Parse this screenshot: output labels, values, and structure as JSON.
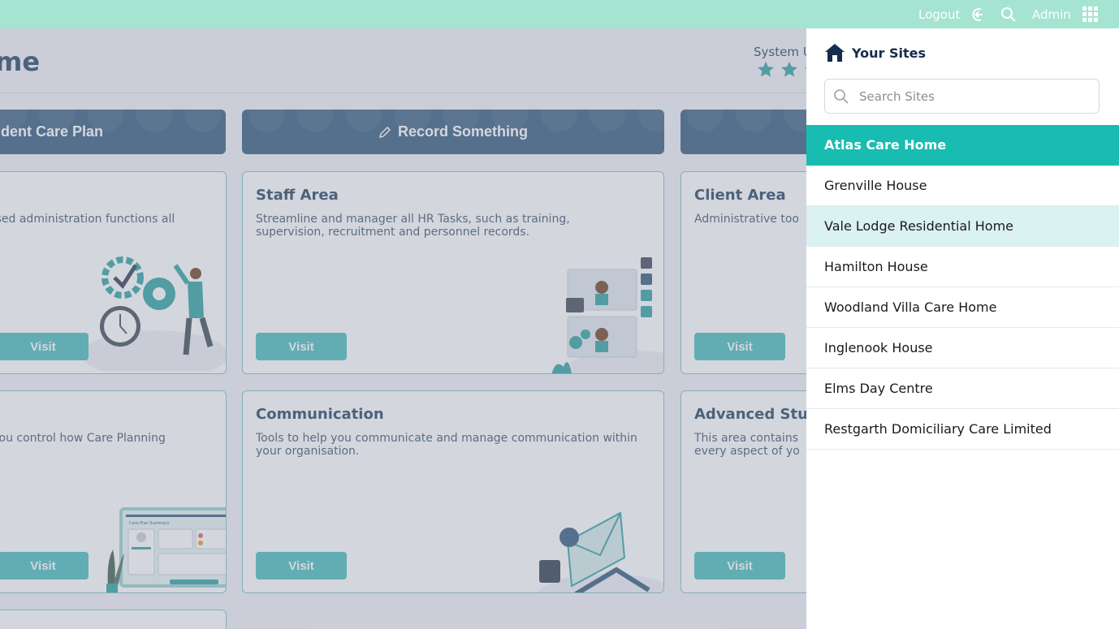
{
  "topbar": {
    "logout_label": "Logout",
    "admin_label": "Admin"
  },
  "page": {
    "title": "me",
    "system_label": "System U",
    "stars_shown": 3
  },
  "actions": [
    {
      "label": "sident Care Plan"
    },
    {
      "label": "Record Something",
      "icon": "pencil-icon"
    },
    {
      "label": ""
    }
  ],
  "cards": [
    {
      "title": "",
      "description": "y used administration functions all",
      "visit_label": "Visit"
    },
    {
      "title": "Staff Area",
      "description": "Streamline and manager all HR Tasks, such as training, supervision, recruitment and personnel records.",
      "visit_label": "Visit"
    },
    {
      "title": "Client Area",
      "description": "Administrative too",
      "visit_label": "Visit"
    },
    {
      "title": "",
      "description": "lp you control how Care Planning",
      "visit_label": "Visit"
    },
    {
      "title": "Communication",
      "description": "Tools to help you communicate and manage communication within your organisation.",
      "visit_label": "Visit"
    },
    {
      "title": "Advanced Stuff",
      "description": "This area contains every aspect of yo",
      "visit_label": "Visit"
    }
  ],
  "illustration_texts": {
    "care_plan_summary": "Care Plan Summary"
  },
  "sites_panel": {
    "title": "Your Sites",
    "search_placeholder": "Search Sites",
    "sites": [
      "Atlas Care Home",
      "Grenville House",
      "Vale Lodge Residential Home",
      "Hamilton House",
      "Woodland Villa Care Home",
      "Inglenook House",
      "Elms Day Centre",
      "Restgarth Domiciliary Care Limited"
    ],
    "active_index": 0,
    "hover_index": 2
  },
  "colors": {
    "topbar": "#a4e4d1",
    "action_button": "#3e6484",
    "visit_button": "#53c1c1",
    "active_site": "#19bcb0",
    "hover_site": "#daf2f1",
    "teal_accent": "#3aa7a8"
  }
}
